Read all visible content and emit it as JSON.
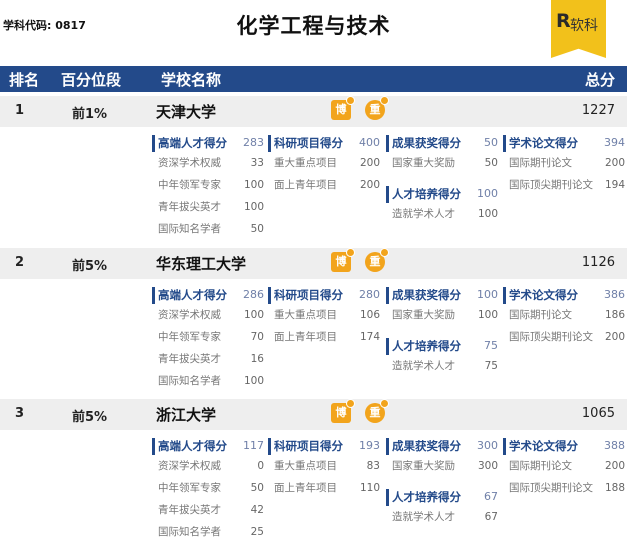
{
  "page": {
    "code_label": "学科代码: 0817",
    "title": "化学工程与技术",
    "logo_text": "软科",
    "logo_letter": "R"
  },
  "header": {
    "rank": "排名",
    "percentile": "百分位段",
    "school": "学校名称",
    "total": "总分"
  },
  "badges": {
    "bo": "博",
    "zhong": "重"
  },
  "categories": {
    "c1": "高端人才得分",
    "c2": "科研项目得分",
    "c3": "成果获奖得分",
    "c3b": "人才培养得分",
    "c4": "学术论文得分"
  },
  "items": {
    "i1": "资深学术权威",
    "i2": "中年领军专家",
    "i3": "青年拔尖英才",
    "i4": "国际知名学者",
    "p1": "重大重点项目",
    "p2": "面上青年项目",
    "a1": "国家重大奖励",
    "t1": "造就学术人才",
    "l1": "国际期刊论文",
    "l2": "国际顶尖期刊论文"
  },
  "universities": [
    {
      "rank": "1",
      "percentile": "前1%",
      "name": "天津大学",
      "score": "1227",
      "c1": "283",
      "i1": "33",
      "i2": "100",
      "i3": "100",
      "i4": "50",
      "c2": "400",
      "p1": "200",
      "p2": "200",
      "c3": "50",
      "a1": "50",
      "c3b": "100",
      "t1": "100",
      "c4": "394",
      "l1": "200",
      "l2": "194"
    },
    {
      "rank": "2",
      "percentile": "前5%",
      "name": "华东理工大学",
      "score": "1126",
      "c1": "286",
      "i1": "100",
      "i2": "70",
      "i3": "16",
      "i4": "100",
      "c2": "280",
      "p1": "106",
      "p2": "174",
      "c3": "100",
      "a1": "100",
      "c3b": "75",
      "t1": "75",
      "c4": "386",
      "l1": "186",
      "l2": "200"
    },
    {
      "rank": "3",
      "percentile": "前5%",
      "name": "浙江大学",
      "score": "1065",
      "c1": "117",
      "i1": "0",
      "i2": "50",
      "i3": "42",
      "i4": "25",
      "c2": "193",
      "p1": "83",
      "p2": "110",
      "c3": "300",
      "a1": "300",
      "c3b": "67",
      "t1": "67",
      "c4": "388",
      "l1": "200",
      "l2": "188"
    }
  ]
}
